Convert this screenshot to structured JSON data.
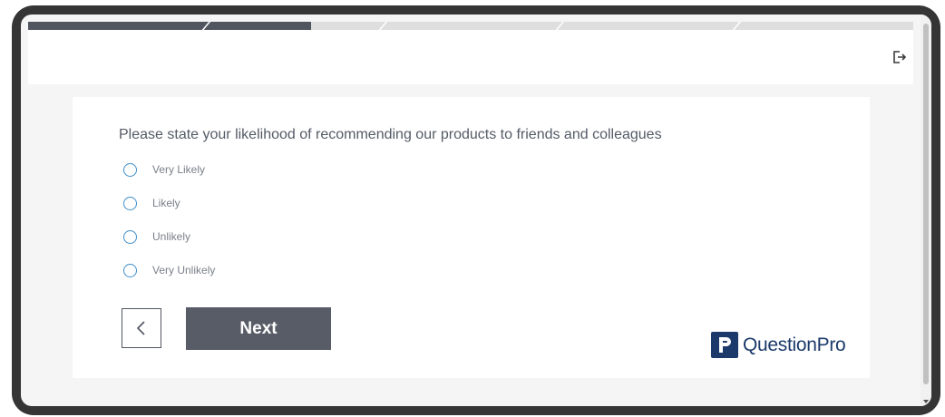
{
  "progress": {
    "completed_fraction": 0.32,
    "segments": 5
  },
  "header": {
    "exit_icon": "logout-icon"
  },
  "question": {
    "text": "Please state your likelihood of recommending our products to friends and colleagues"
  },
  "options": [
    {
      "label": "Very Likely",
      "selected": false
    },
    {
      "label": "Likely",
      "selected": false
    },
    {
      "label": "Unlikely",
      "selected": false
    },
    {
      "label": "Very Unlikely",
      "selected": false
    }
  ],
  "navigation": {
    "back_icon": "chevron-left-icon",
    "next_label": "Next"
  },
  "brand": {
    "name": "QuestionPro",
    "color": "#1b3a6b"
  },
  "colors": {
    "progress_fill": "#50555f",
    "radio_border": "#3e8ecb",
    "next_button": "#575c67"
  }
}
